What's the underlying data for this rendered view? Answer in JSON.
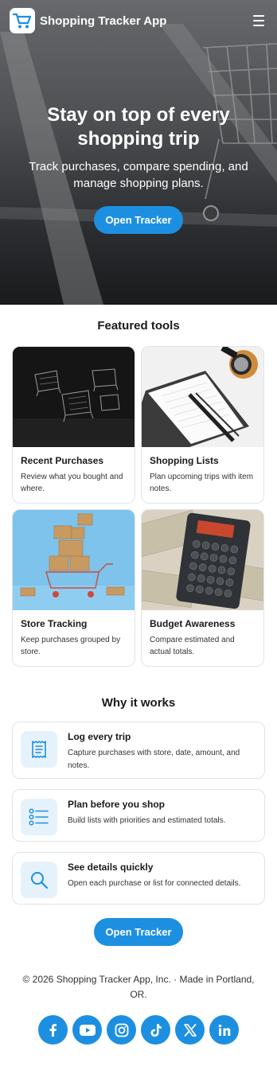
{
  "header": {
    "app_title": "Shopping Tracker App"
  },
  "hero": {
    "title": "Stay on top of every shopping trip",
    "subtitle": "Track purchases, compare spending, and manage shopping plans.",
    "cta_label": "Open Tracker"
  },
  "featured": {
    "title": "Featured tools",
    "cards": [
      {
        "title": "Recent Purchases",
        "desc": "Review what you bought and where."
      },
      {
        "title": "Shopping Lists",
        "desc": "Plan upcoming trips with item notes."
      },
      {
        "title": "Store Tracking",
        "desc": "Keep purchases grouped by store."
      },
      {
        "title": "Budget Awareness",
        "desc": "Compare estimated and actual totals."
      }
    ]
  },
  "why": {
    "title": "Why it works",
    "items": [
      {
        "title": "Log every trip",
        "desc": "Capture purchases with store, date, amount, and notes.",
        "icon": "receipt-icon"
      },
      {
        "title": "Plan before you shop",
        "desc": "Build lists with priorities and estimated totals.",
        "icon": "list-icon"
      },
      {
        "title": "See details quickly",
        "desc": "Open each purchase or list for connected details.",
        "icon": "search-icon"
      }
    ]
  },
  "cta_bottom": {
    "label": "Open Tracker"
  },
  "footer": {
    "text": "© 2026 Shopping Tracker App, Inc. · Made in Portland, OR.",
    "socials": [
      "facebook-icon",
      "youtube-icon",
      "instagram-icon",
      "tiktok-icon",
      "x-icon",
      "linkedin-icon"
    ]
  },
  "colors": {
    "accent": "#1d8fe0",
    "icon_bg": "#e6f2fb",
    "border": "#e1e4e8"
  }
}
